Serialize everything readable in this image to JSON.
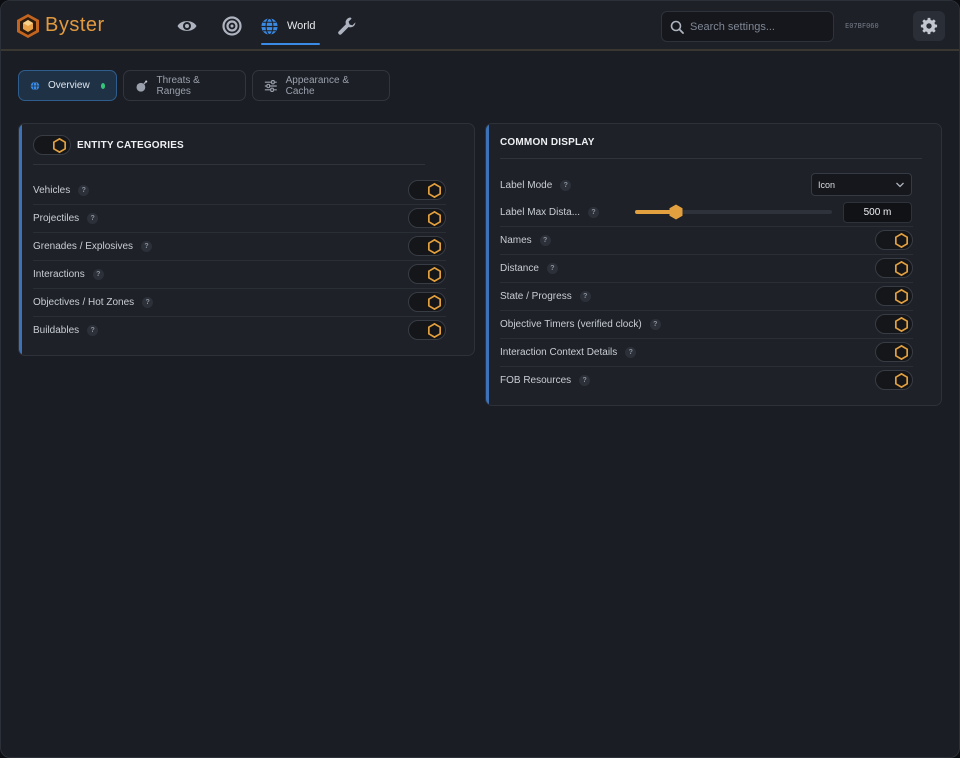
{
  "app": {
    "brand": "Byster",
    "build_id": "E07BF060",
    "accent": "#e3a03e",
    "primary": "#3a8be6"
  },
  "nav": {
    "items": [
      {
        "icon": "eye-icon",
        "label": ""
      },
      {
        "icon": "target-icon",
        "label": ""
      },
      {
        "icon": "globe-icon",
        "label": "World",
        "active": true
      },
      {
        "icon": "wrench-icon",
        "label": ""
      }
    ]
  },
  "search": {
    "placeholder": "Search settings..."
  },
  "tabs": [
    {
      "label": "Overview",
      "icon": "globe-icon",
      "active": true,
      "status": "online"
    },
    {
      "label": "Threats & Ranges",
      "icon": "bomb-icon"
    },
    {
      "label": "Appearance & Cache",
      "icon": "sliders-icon"
    }
  ],
  "entity_panel": {
    "title": "ENTITY CATEGORIES",
    "master_enabled": true,
    "items": [
      {
        "label": "Vehicles",
        "enabled": true
      },
      {
        "label": "Projectiles",
        "enabled": true
      },
      {
        "label": "Grenades / Explosives",
        "enabled": true
      },
      {
        "label": "Interactions",
        "enabled": true
      },
      {
        "label": "Objectives / Hot Zones",
        "enabled": true
      },
      {
        "label": "Buildables",
        "enabled": true
      }
    ]
  },
  "display_panel": {
    "title": "COMMON DISPLAY",
    "label_mode": {
      "label": "Label Mode",
      "value": "Icon"
    },
    "label_max_distance": {
      "label": "Label Max Dista...",
      "value_text": "500 m",
      "fraction": 0.21
    },
    "items": [
      {
        "label": "Names",
        "enabled": true
      },
      {
        "label": "Distance",
        "enabled": true
      },
      {
        "label": "State / Progress",
        "enabled": true
      },
      {
        "label": "Objective Timers (verified clock)",
        "enabled": true
      },
      {
        "label": "Interaction Context Details",
        "enabled": true
      },
      {
        "label": "FOB Resources",
        "enabled": true
      }
    ]
  },
  "help_glyph": "?"
}
